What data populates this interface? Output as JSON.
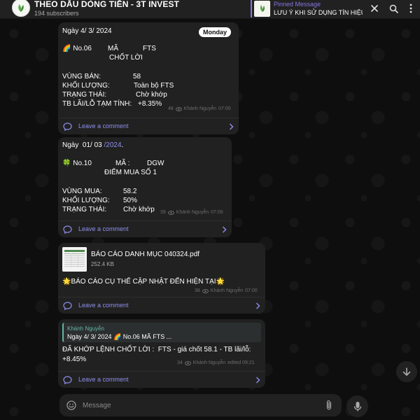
{
  "header": {
    "channel_title": "THEO DẤU DÒNG TIỀN - 3T INVEST",
    "subscribers": "194 subscribers",
    "pinned_title": "Pinned Message",
    "pinned_text": "LƯU Ý KHI SỬ DỤNG TÍN HIỆU..."
  },
  "colors": {
    "accent": "#8774e1",
    "link": "#8f8fef",
    "bubble": "#212121",
    "reply_accent": "#65b4a4"
  },
  "messages": [
    {
      "date_line": "Ngày 4/ 3/ 2024",
      "day_badge": "Monday",
      "line_no": "🌈 No.06",
      "code_label": "MÃ",
      "code_value": "FTS",
      "action": "CHỐT LỜI",
      "row1_label": "VÙNG BÁN:",
      "row1_value": "58",
      "row2_label": "KHỐI LƯỢNG:",
      "row2_value": "Toàn bộ FTS",
      "row3_label": "TRẠNG THÁI:",
      "row3_value": "Chờ khớp",
      "row4_label": "TB LÃI/LỖ TẠM TÍNH:",
      "row4_value": "+8.35%",
      "views": "48",
      "author": "Khánh Nguyễn",
      "time": "07:00",
      "comment_label": "Leave a comment"
    },
    {
      "date_prefix": "Ngày  01/ 03 ",
      "date_link": "/2024",
      "date_suffix": ".",
      "line_no": "🍀 No.10",
      "code_label": "MÃ :",
      "code_value": "DGW",
      "action": "ĐIỂM MUA SỐ 1",
      "row1_label": "VÙNG MUA:",
      "row1_value": "58.2",
      "row2_label": "KHỐI LƯỢNG:",
      "row2_value": "50%",
      "row3_label": "TRẠNG THÁI:",
      "row3_value": "Chờ khớp",
      "views": "39",
      "author": "Khánh Nguyễn",
      "time": "07:00",
      "comment_label": "Leave a comment"
    },
    {
      "file_name": "BÁO CÁO DANH MỤC 040324.pdf",
      "file_size": "252.4 KB",
      "caption": "🌟BÁO CÁO CỤ THỂ CẬP NHẬT ĐẾN HIỆN TẠI🌟",
      "views": "38",
      "author": "Khánh Nguyễn",
      "time": "07:00",
      "comment_label": "Leave a comment"
    },
    {
      "reply_author": "Khánh Nguyễn",
      "reply_text": "Ngày 4/ 3/ 2024 🌈 No.06 MÃ FTS ...",
      "text_line1": "ĐÃ KHỚP LỆNH CHỐT LỜI :  FTS - giá chốt 58.1 - TB lãi/lỗ:",
      "text_line2": "+8.45%",
      "views": "34",
      "author": "Khánh Nguyễn",
      "edited_time": "edited 09:21",
      "comment_label": "Leave a comment"
    }
  ],
  "composer": {
    "placeholder": "Message"
  },
  "icons": {
    "search": "search-icon",
    "close": "close-icon",
    "menu": "more-vertical-icon",
    "emoji": "emoji-icon",
    "attach": "paperclip-icon",
    "mic": "microphone-icon",
    "scroll_down": "arrow-down-icon"
  }
}
